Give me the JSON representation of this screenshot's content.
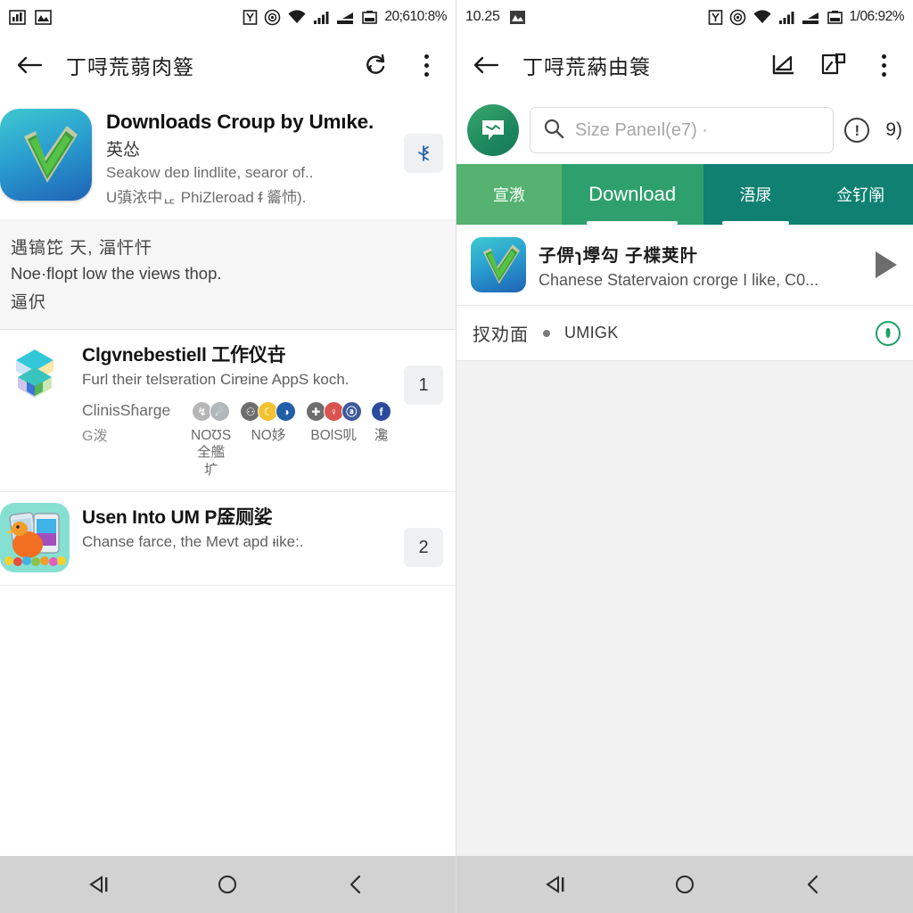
{
  "left": {
    "statusbar": {
      "icon1": "chart-icon",
      "icon2": "image-icon",
      "sim": "sim-icon",
      "mute": "mute-icon",
      "wifi": "wifi-icon",
      "signal": "signal-icon",
      "signal2": "signal-bars-icon",
      "battery_icon": "battery-icon",
      "text": "20;610:8%"
    },
    "appbar": {
      "back": "back-arrow-icon",
      "title": "丁㖊荒蒻肉簦",
      "refresh": "refresh-icon",
      "overflow": "overflow-menu-icon"
    },
    "hero": {
      "icon": "download-check-app-icon",
      "title": "Downloads Croup by Umıke.",
      "subtitle1": "英怂",
      "subtitle2": "Seakow deɒ lindlite, searor of..",
      "subtitle3": "U㣀㳖中ᇆ PhiZleroad ᵮ 䶴㤄).",
      "badge": "⚙"
    },
    "note": {
      "line1": "遇镐笓 天, 湢忓忓",
      "line2": "Noe·flopt low the views thop.",
      "line3": "逼伬"
    },
    "rows": [
      {
        "icon": "cube-layers-app-icon",
        "title": "Clgvnebestiell 工作仪卋",
        "subtitle": "Furl their telsɐration Cirɐine AppS koch.",
        "badge": "1",
        "social": [
          {
            "name": "ClinisSɦarge",
            "name2": "G泼",
            "dots": [],
            "label": ""
          },
          {
            "dots": [
              "#b6b6b6",
              "#b0b8bb"
            ],
            "label": "NOƱS\n全艦圹"
          },
          {
            "dots": [
              "#6e6e6e",
              "#f2c230",
              "#1f5fa8"
            ],
            "label": "NO姼"
          },
          {
            "dots": [
              "#6e6e6e",
              "#d9534f",
              "#3d5a98"
            ],
            "label": "BOƖS䶷"
          },
          {
            "dots": [
              "#2b4a9b"
            ],
            "label": "瀺"
          }
        ]
      },
      {
        "icon": "chicken-phones-app-icon",
        "title": "Usen Into UM P㕋厕娑",
        "subtitle": "Chanse farce, the Mevt apd ᵼike:.",
        "badge": "2",
        "social": []
      }
    ],
    "navbar": {
      "recent": "recent-apps-icon",
      "home": "home-icon",
      "back": "back-icon"
    }
  },
  "right": {
    "statusbar": {
      "clock": "10.25",
      "icon1": "image-icon",
      "sim": "sim-icon",
      "mute": "mute-icon",
      "wifi": "wifi-icon",
      "signal": "signal-icon",
      "signal2": "signal-bars-icon",
      "battery_icon": "battery-icon",
      "text": "1/06:92%"
    },
    "appbar": {
      "back": "back-arrow-icon",
      "title": "丁㖊荒蒳由簑",
      "action1": "chart-up-icon",
      "action2": "edit-note-icon",
      "overflow": "overflow-menu-icon"
    },
    "search": {
      "avatar": "speech-bubble-avatar-icon",
      "search_icon": "search-icon",
      "placeholder": "Size Paneıl(e7) ·",
      "info_icon": "info-circle-icon",
      "count": "9)"
    },
    "tabs": [
      {
        "label": "宣漖",
        "color": "#55b271",
        "active": false,
        "wide": false
      },
      {
        "label": "Download",
        "color": "#2ea06e",
        "active": true,
        "wide": true
      },
      {
        "label": "浯㞗",
        "color": "#0f8071",
        "active": true,
        "wide": false
      },
      {
        "label": "佥钌䦶",
        "color": "#0f8071",
        "active": false,
        "wide": false
      }
    ],
    "item": {
      "icon": "download-check-app-icon",
      "title": "子㑭ɿ㙾勾 子楪荚䦹",
      "subtitle": "Chanese Statervaion crorge I like, C0...",
      "play": "play-icon"
    },
    "meta": {
      "label": "扠劝面",
      "value": "UMIGK",
      "action": "record-circle-icon"
    },
    "navbar": {
      "recent": "recent-apps-icon",
      "home": "home-icon",
      "back": "back-icon"
    }
  }
}
